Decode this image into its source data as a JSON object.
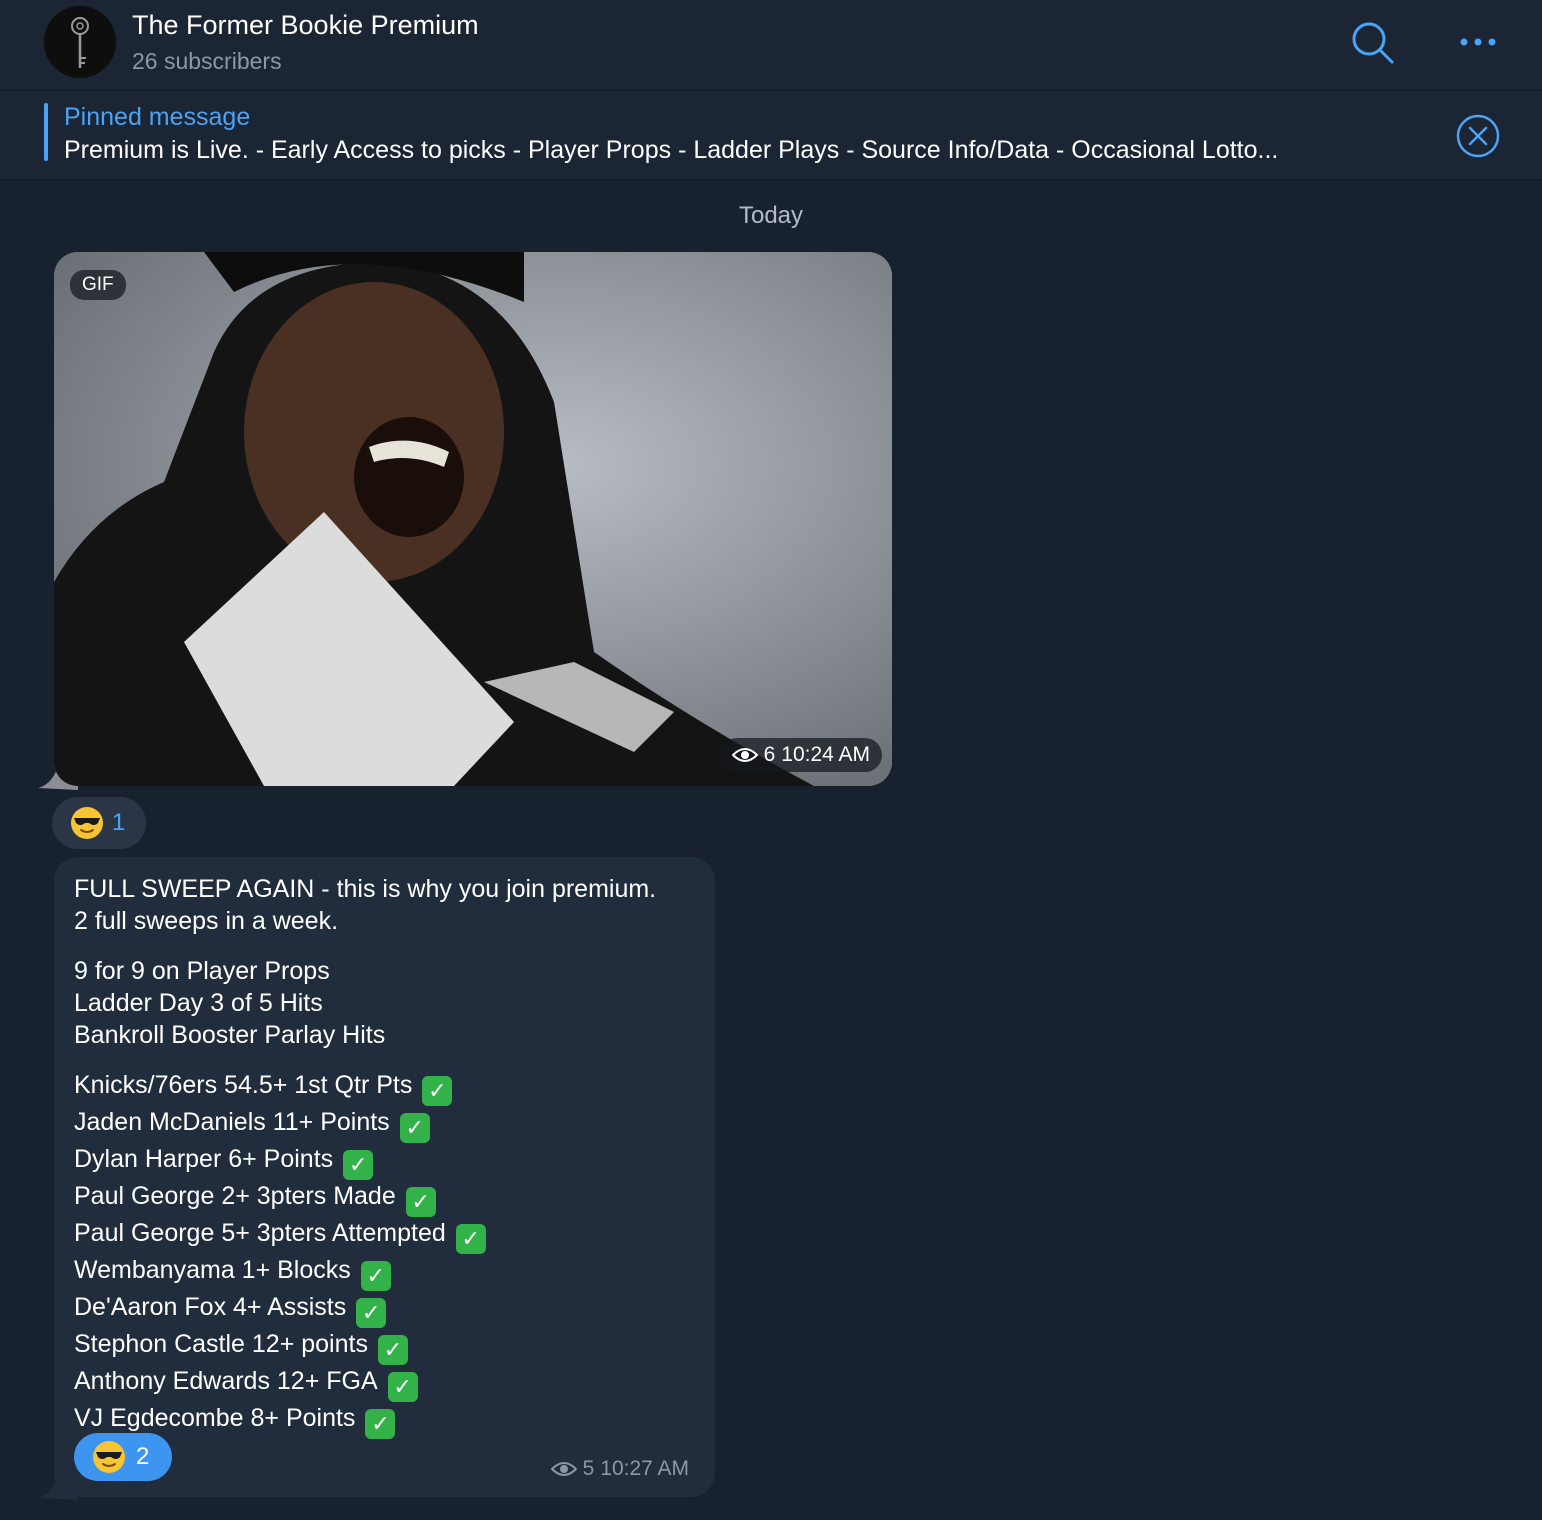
{
  "header": {
    "title": "The Former Bookie Premium",
    "subtitle": "26 subscribers",
    "search_icon": "search-icon",
    "more_icon": "more-icon"
  },
  "pinned": {
    "title": "Pinned message",
    "text": "Premium is Live.  - Early Access to picks  - Player Props  - Ladder Plays  - Source Info/Data  - Occasional Lotto..."
  },
  "date_separator": "Today",
  "gif_message": {
    "label": "GIF",
    "views": "6",
    "time": "10:24 AM",
    "reaction": {
      "emoji": "smiling-face-with-sunglasses",
      "count": "1"
    }
  },
  "text_message": {
    "para1": [
      "FULL SWEEP AGAIN - this is why you join premium.",
      "2 full sweeps in a week."
    ],
    "para2": [
      "9 for 9 on Player Props",
      "Ladder Day 3 of 5 Hits",
      "Bankroll Booster Parlay Hits"
    ],
    "picks": [
      "Knicks/76ers 54.5+ 1st Qtr Pts",
      "Jaden McDaniels 11+ Points",
      "Dylan Harper 6+ Points",
      "Paul George 2+ 3pters Made",
      "Paul George 5+ 3pters Attempted",
      "Wembanyama 1+ Blocks",
      "De'Aaron Fox 4+ Assists",
      "Stephon Castle 12+ points",
      "Anthony Edwards 12+ FGA",
      "VJ Egdecombe 8+ Points"
    ],
    "check_icon": "check-mark-button",
    "reaction": {
      "emoji": "smiling-face-with-sunglasses",
      "count": "2"
    },
    "views": "5",
    "time": "10:27 AM"
  },
  "colors": {
    "background": "#18212e",
    "header": "#1c2533",
    "accent": "#4aa3f5",
    "bubble": "#212d3d",
    "check": "#34b24a"
  }
}
